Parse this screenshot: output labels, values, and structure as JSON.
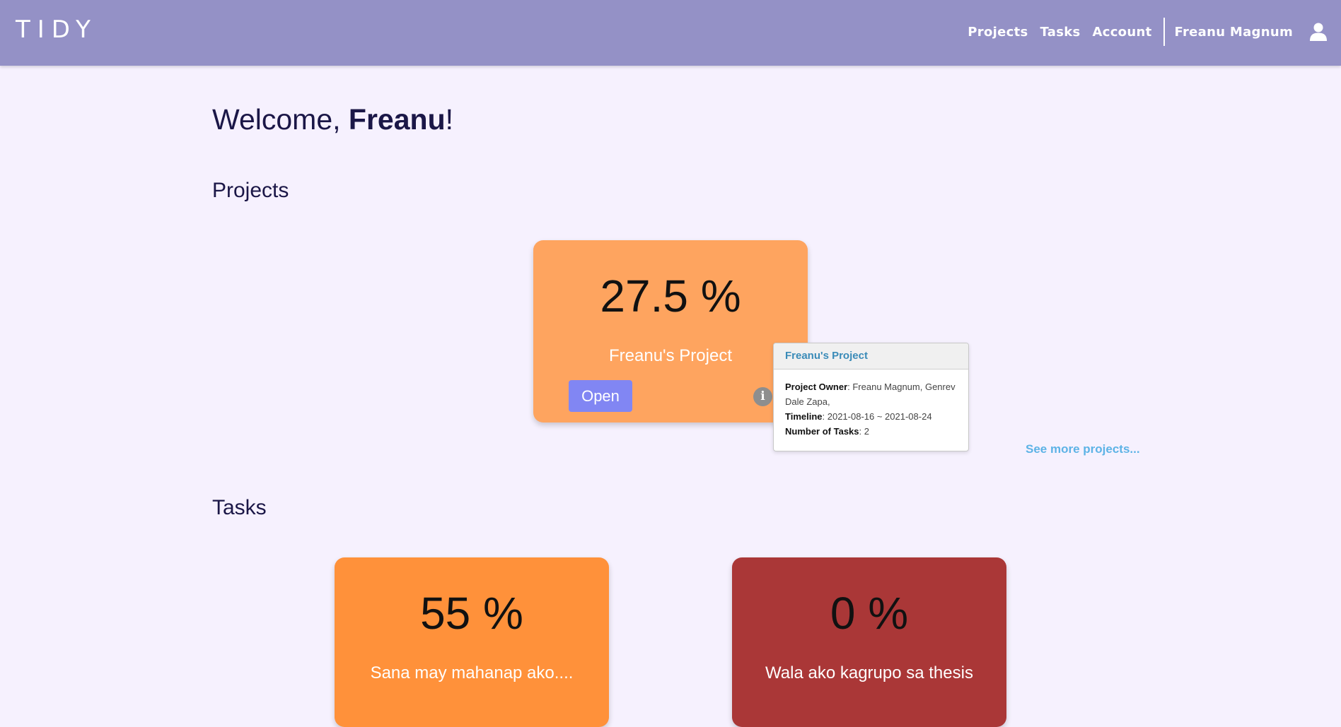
{
  "navbar": {
    "brand": "TIDY",
    "links": [
      "Projects",
      "Tasks",
      "Account"
    ],
    "user_name": "Freanu Magnum"
  },
  "welcome": {
    "prefix": "Welcome, ",
    "name": "Freanu",
    "suffix": "!"
  },
  "projects": {
    "title": "Projects",
    "cards": [
      {
        "percent": "27.5 %",
        "name": "Freanu's Project",
        "open_label": "Open",
        "color": "#fea45f"
      }
    ],
    "popover": {
      "title": "Freanu's Project",
      "owner_label": "Project Owner",
      "owner_value": ": Freanu Magnum, Genrev Dale Zapa,",
      "timeline_label": "Timeline",
      "timeline_value": ": 2021-08-16 ~ 2021-08-24",
      "tasks_label": "Number of Tasks",
      "tasks_value": ": 2"
    },
    "see_more": "See more projects..."
  },
  "tasks": {
    "title": "Tasks",
    "cards": [
      {
        "percent": "55 %",
        "name": "Sana may mahanap ako....",
        "color": "#ff913a"
      },
      {
        "percent": "0 %",
        "name": "Wala ako kagrupo sa thesis",
        "color": "#aa3737"
      }
    ]
  }
}
